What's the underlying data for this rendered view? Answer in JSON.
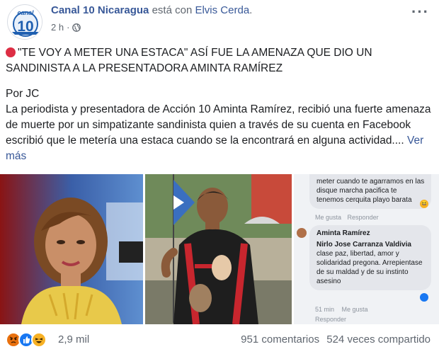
{
  "post": {
    "page_name": "Canal 10 Nicaragua",
    "with_text": "está con",
    "tagged_person": "Elvis Cerda",
    "time": "2 h",
    "audience_icon": "globe-icon",
    "logo_text": "canal",
    "logo_number": "10",
    "headline": "\"TE VOY A METER UNA ESTACA\" ASÍ FUE LA AMENAZA QUE DIO UN SANDINISTA A LA PRESENTADORA AMINTA RAMÍREZ",
    "byline": "Por JC",
    "body": "La periodista y presentadora de Acción 10 Aminta Ramírez, recibió una fuerte amenaza de muerte por un simpatizante sandinista quien a través de su cuenta en Facebook escribió que le metería una estaca cuando se la encontrará en alguna actividad....",
    "see_more": "Ver más"
  },
  "screenshot_comment": {
    "prev_text": "meter cuando te agarramos en las disque marcha pacifica te tenemos cerquita playo barata",
    "prev_like": "Me gusta",
    "prev_reply": "Responder",
    "author": "Aminta Ramírez",
    "mention": "Nirlo Jose Carranza Valdivia",
    "text": "clase paz, libertad, amor y solidaridad pregona. Arrepientase de su maldad y de su instinto asesino",
    "time": "51 min",
    "like": "Me gusta",
    "reply": "Responder"
  },
  "footer": {
    "reaction_count": "2,9 mil",
    "comments": "951 comentarios",
    "shares": "524 veces compartido"
  },
  "colors": {
    "link": "#385898",
    "text": "#1c1e21",
    "muted": "#606770",
    "angry": "#e9710f",
    "like": "#1877f2",
    "haha": "#f7b125"
  }
}
